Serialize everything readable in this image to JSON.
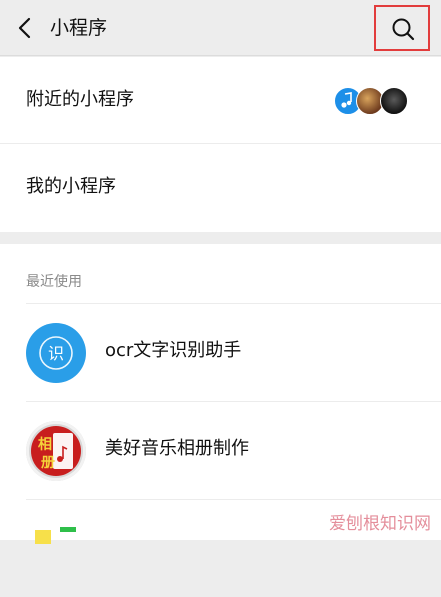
{
  "header": {
    "title": "小程序",
    "back_icon": "chevron-left-icon",
    "search_icon": "search-icon",
    "highlight_color": "#e23c3c"
  },
  "menu": {
    "nearby_label": "附近的小程序",
    "mine_label": "我的小程序"
  },
  "recent": {
    "section_label": "最近使用",
    "items": [
      {
        "name": "ocr文字识别助手",
        "icon": "ocr-icon",
        "icon_char": "识"
      },
      {
        "name": "美好音乐相册制作",
        "icon": "music-album-icon",
        "icon_chars": [
          "相",
          "册"
        ]
      },
      {
        "name": "",
        "icon": "partial-app-icon"
      }
    ]
  },
  "watermark": "爱刨根知识网"
}
